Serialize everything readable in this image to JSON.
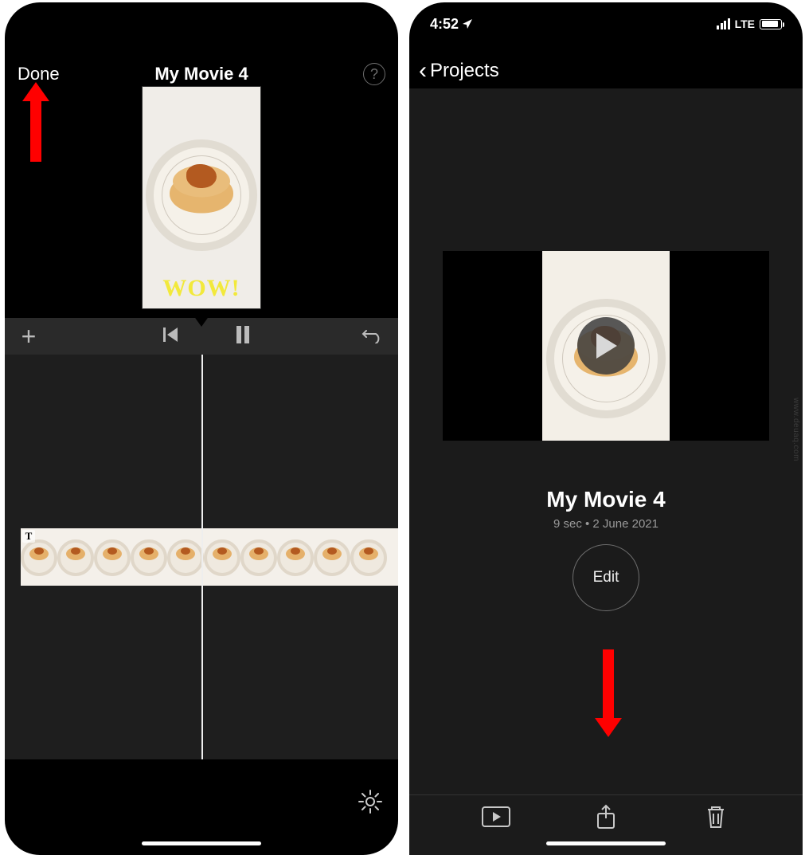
{
  "left": {
    "done_label": "Done",
    "title": "My Movie 4",
    "overlay_text": "WOW!",
    "help_glyph": "?",
    "add_glyph": "+",
    "timeline_text_badge": "T"
  },
  "right": {
    "status": {
      "time": "4:52",
      "carrier": "LTE"
    },
    "back_label": "Projects",
    "project_title": "My Movie 4",
    "project_meta": "9 sec • 2 June 2021",
    "edit_label": "Edit"
  },
  "watermark": "www.deuaq.com"
}
